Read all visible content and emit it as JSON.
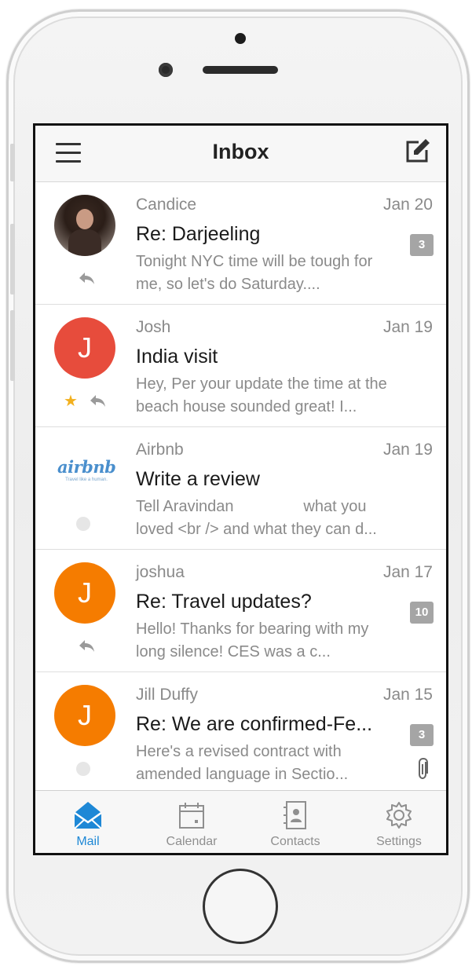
{
  "header": {
    "title": "Inbox",
    "menu_icon": "hamburger-menu-icon",
    "compose_icon": "compose-icon"
  },
  "emails": [
    {
      "sender": "Candice",
      "date": "Jan 20",
      "subject": "Re: Darjeeling",
      "preview": "Tonight NYC time will be tough for me, so let's do Saturday....",
      "badge": "3",
      "avatar": "photo",
      "status_icons": [
        "reply-icon"
      ]
    },
    {
      "sender": "Josh",
      "date": "Jan 19",
      "subject": "India visit",
      "preview": "Hey, Per your update the time at the beach house sounded great! I...",
      "badge": "",
      "avatar_letter": "J",
      "avatar_color": "#e74c3c",
      "status_icons": [
        "star-icon",
        "reply-icon"
      ]
    },
    {
      "sender": "Airbnb",
      "date": "Jan 19",
      "subject": "Write a review",
      "preview": "Tell Aravindan                what you loved <br /> and what they can d...",
      "badge": "",
      "avatar_logo_text": "airbnb",
      "avatar_logo_tagline": "Travel like a human.",
      "status_icons": [
        "unread-dot-icon"
      ]
    },
    {
      "sender": "joshua",
      "date": "Jan 17",
      "subject": "Re: Travel updates?",
      "preview": "Hello! Thanks for bearing with my long silence! CES was a c...",
      "badge": "10",
      "avatar_letter": "J",
      "avatar_color": "#f57c00",
      "status_icons": [
        "reply-icon"
      ]
    },
    {
      "sender": "Jill Duffy",
      "date": "Jan 15",
      "subject": "Re: We are confirmed-Fe...",
      "preview": "Here's a revised contract with amended language in Sectio...",
      "badge": "3",
      "avatar_letter": "J",
      "avatar_color": "#f57c00",
      "status_icons": [
        "unread-dot-icon"
      ],
      "attachment_icon": "paperclip-icon"
    }
  ],
  "tabs": [
    {
      "label": "Mail",
      "icon": "mail-icon",
      "active": true
    },
    {
      "label": "Calendar",
      "icon": "calendar-icon",
      "active": false
    },
    {
      "label": "Contacts",
      "icon": "contacts-icon",
      "active": false
    },
    {
      "label": "Settings",
      "icon": "settings-gear-icon",
      "active": false
    }
  ],
  "colors": {
    "accent": "#1e88d6",
    "badge": "#a5a5a5",
    "star": "#f2b01e"
  }
}
